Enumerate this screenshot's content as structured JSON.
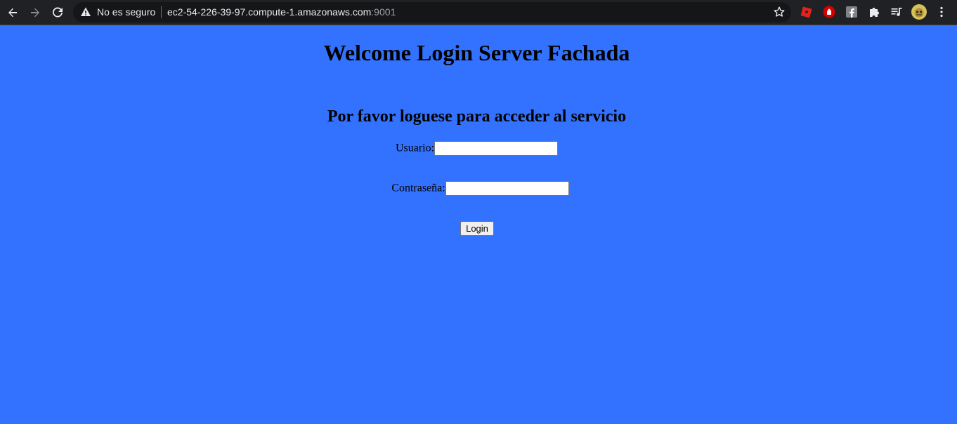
{
  "browser": {
    "security_label": "No es seguro",
    "url_host": "ec2-54-226-39-97.compute-1.amazonaws.com",
    "url_port": ":9001",
    "extensions": [
      "roblox-icon",
      "stop-hand-icon",
      "facebook-icon",
      "puzzle-extensions-icon",
      "media-control-icon",
      "profile-avatar"
    ]
  },
  "page": {
    "title": "Welcome Login Server Fachada",
    "subtitle": "Por favor loguese para acceder al servicio",
    "username_label": "Usuario:",
    "username_value": "",
    "password_label": "Contraseña:",
    "password_value": "",
    "login_label": "Login"
  },
  "colors": {
    "page_background": "#3372ff",
    "chrome_background": "#202124"
  }
}
